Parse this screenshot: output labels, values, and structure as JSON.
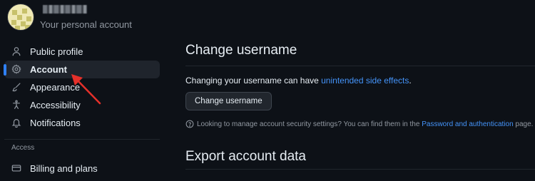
{
  "profile": {
    "subtitle": "Your personal account"
  },
  "sidebar": {
    "items": [
      {
        "label": "Public profile",
        "icon": "person-icon"
      },
      {
        "label": "Account",
        "icon": "gear-icon"
      },
      {
        "label": "Appearance",
        "icon": "paintbrush-icon"
      },
      {
        "label": "Accessibility",
        "icon": "accessibility-icon"
      },
      {
        "label": "Notifications",
        "icon": "bell-icon"
      }
    ],
    "access_heading": "Access",
    "access_items": [
      {
        "label": "Billing and plans",
        "icon": "credit-card-icon"
      }
    ]
  },
  "main": {
    "change_username": {
      "title": "Change username",
      "text_prefix": "Changing your username can have ",
      "link": "unintended side effects",
      "text_suffix": ".",
      "button": "Change username",
      "note_prefix": "Looking to manage account security settings? You can find them in the ",
      "note_link": "Password and authentication",
      "note_suffix": " page."
    },
    "export": {
      "title": "Export account data"
    }
  },
  "colors": {
    "background": "#0d1117",
    "link": "#4493f8",
    "active_indicator": "#2f81f7",
    "annotation_arrow": "#e5302a"
  }
}
